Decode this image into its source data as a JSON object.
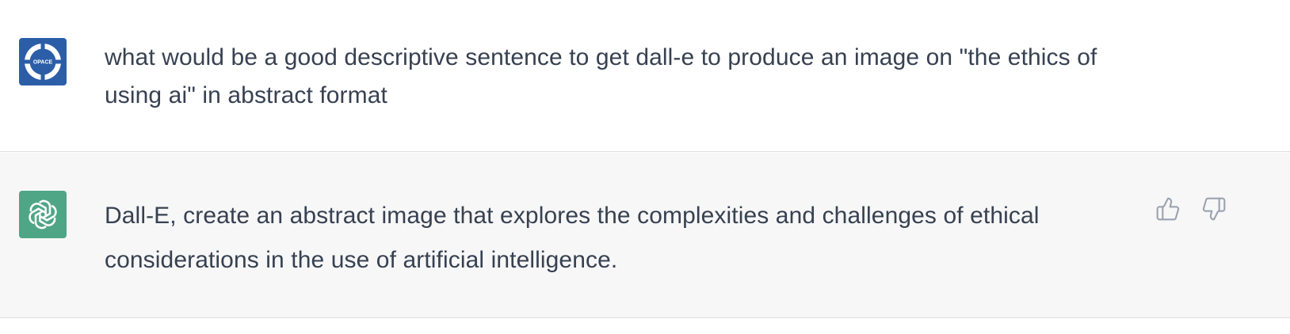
{
  "conversation": {
    "user_message": {
      "avatar_label": "OPACE",
      "avatar_color": "#2b5ea7",
      "text": "what would be a good descriptive sentence to get dall-e to produce an image on \"the ethics of using ai\" in abstract format"
    },
    "assistant_message": {
      "avatar_icon": "openai-logo-icon",
      "avatar_color": "#4ea687",
      "text": "Dall-E, create an abstract image that explores the complexities and challenges of ethical considerations in the use of artificial intelligence."
    },
    "feedback": {
      "thumbs_up_icon": "thumbs-up-icon",
      "thumbs_down_icon": "thumbs-down-icon"
    }
  }
}
